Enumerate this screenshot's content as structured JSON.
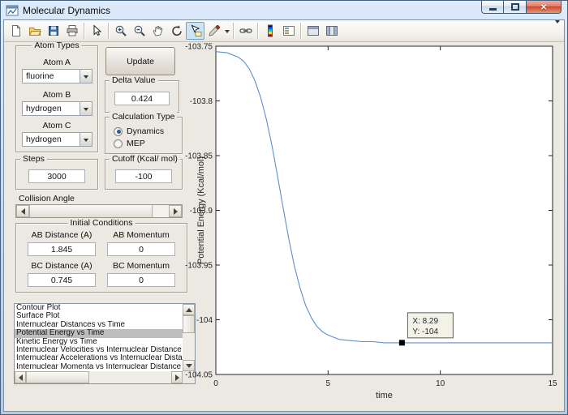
{
  "window": {
    "title": "Molecular Dynamics",
    "controls": [
      "minimize",
      "maximize",
      "close"
    ]
  },
  "toolbar": {
    "icons": [
      "new-figure",
      "open-file",
      "save-figure",
      "print-figure",
      "edit-plot",
      "zoom-in",
      "zoom-out",
      "pan",
      "rotate-3d",
      "data-cursor",
      "brush",
      "brush-dropdown",
      "link-plot",
      "insert-colorbar",
      "insert-legend",
      "hide-plot-tools",
      "show-plot-tools",
      "toolbar-overflow"
    ],
    "active_icon": "data-cursor"
  },
  "panel": {
    "atom_types": {
      "title": "Atom Types",
      "atom_a_label": "Atom A",
      "atom_a_value": "fluorine",
      "atom_b_label": "Atom B",
      "atom_b_value": "hydrogen",
      "atom_c_label": "Atom C",
      "atom_c_value": "hydrogen"
    },
    "update_button": "Update",
    "delta": {
      "title": "Delta Value",
      "value": "0.424"
    },
    "calc_type": {
      "title": "Calculation Type",
      "options": [
        {
          "label": "Dynamics",
          "selected": true
        },
        {
          "label": "MEP",
          "selected": false
        }
      ]
    },
    "steps": {
      "title": "Steps",
      "value": "3000"
    },
    "cutoff": {
      "title": "Cutoff (Kcal/ mol)",
      "value": "-100"
    },
    "collision_angle_label": "Collision Angle",
    "initial_conditions": {
      "title": "Initial Conditions",
      "ab_distance_label": "AB Distance (A)",
      "ab_distance_value": "1.845",
      "ab_momentum_label": "AB Momentum",
      "ab_momentum_value": "0",
      "bc_distance_label": "BC Distance (A)",
      "bc_distance_value": "0.745",
      "bc_momentum_label": "BC Momentum",
      "bc_momentum_value": "0"
    },
    "plot_list": {
      "items": [
        "Contour Plot",
        "Surface Plot",
        "Internuclear Distances vs Time",
        "Potential Energy vs Time",
        "Kinetic Energy vs Time",
        "Internuclear Velocities vs Internuclear Distance",
        "Internuclear Accelerations vs Internuclear Distance",
        "Internuclear Momenta vs Internuclear Distance"
      ],
      "selected_index": 3
    }
  },
  "chart_data": {
    "type": "line",
    "title": "",
    "xlabel": "time",
    "ylabel": "Potential Energy (Kcal/mol)",
    "xlim": [
      0,
      15
    ],
    "ylim": [
      -104.05,
      -103.75
    ],
    "xticks": [
      0,
      5,
      10,
      15
    ],
    "yticks": [
      -103.75,
      -103.8,
      -103.85,
      -103.9,
      -103.95,
      -104,
      -104.05
    ],
    "grid": false,
    "legend": false,
    "line_color": "#5b8fc9",
    "series": [
      {
        "name": "Potential Energy vs Time",
        "x": [
          0,
          0.5,
          1,
          1.25,
          1.5,
          1.75,
          2,
          2.25,
          2.5,
          2.75,
          3,
          3.25,
          3.5,
          3.75,
          4,
          4.25,
          4.5,
          4.75,
          5,
          5.25,
          5.5,
          6,
          6.5,
          7,
          7.5,
          8,
          8.29,
          9,
          10,
          11,
          12,
          13,
          14,
          15
        ],
        "y": [
          -103.755,
          -103.756,
          -103.76,
          -103.764,
          -103.771,
          -103.782,
          -103.797,
          -103.817,
          -103.841,
          -103.869,
          -103.898,
          -103.926,
          -103.951,
          -103.971,
          -103.987,
          -103.998,
          -104.006,
          -104.011,
          -104.014,
          -104.016,
          -104.018,
          -104.019,
          -104.02,
          -104.02,
          -104.021,
          -104.021,
          -104.021,
          -104.021,
          -104.021,
          -104.021,
          -104.021,
          -104.021,
          -104.021,
          -104.021
        ]
      }
    ],
    "datatip": {
      "x": 8.29,
      "y": -104.021,
      "label_x": "X: 8.29",
      "label_y": "Y: -104",
      "bg": "#f2f2e6",
      "border": "#5e5e5e"
    }
  }
}
